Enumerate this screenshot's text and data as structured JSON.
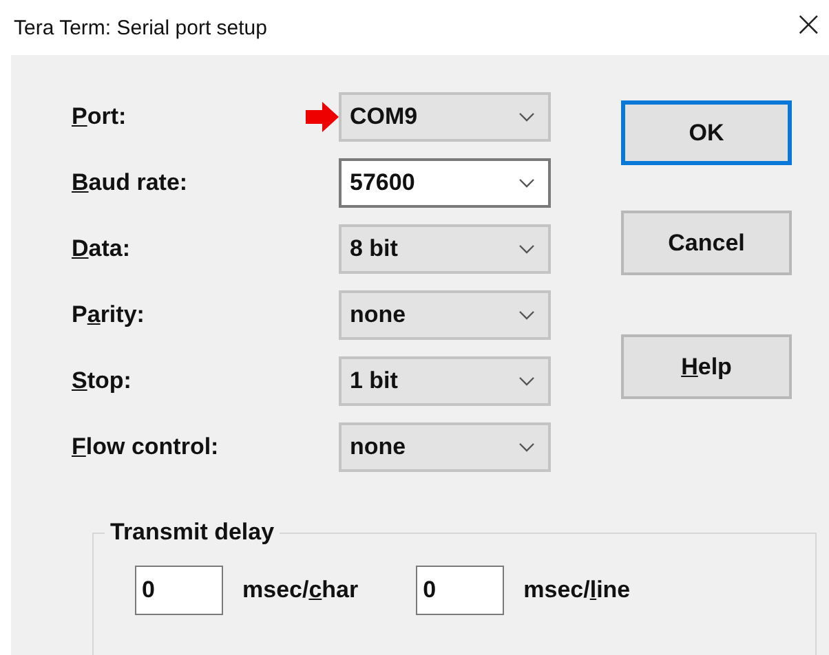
{
  "window": {
    "title": "Tera Term: Serial port setup",
    "close": "×"
  },
  "fields": [
    {
      "label": {
        "key": "P",
        "after": "ort:"
      },
      "value": "COM9",
      "focused": false,
      "annotated": true
    },
    {
      "label": {
        "key": "B",
        "after": "aud rate:"
      },
      "value": "57600",
      "focused": true,
      "annotated": false
    },
    {
      "label": {
        "key": "D",
        "after": "ata:"
      },
      "value": "8 bit",
      "focused": false,
      "annotated": false
    },
    {
      "label": {
        "before": "P",
        "key": "a",
        "after": "rity:"
      },
      "value": "none",
      "focused": false,
      "annotated": false
    },
    {
      "label": {
        "key": "S",
        "after": "top:"
      },
      "value": "1 bit",
      "focused": false,
      "annotated": false
    },
    {
      "label": {
        "key": "F",
        "after": "low control:"
      },
      "value": "none",
      "focused": false,
      "annotated": false
    }
  ],
  "buttons": [
    {
      "label": {
        "after": "OK"
      },
      "default": true
    },
    {
      "label": {
        "after": "Cancel"
      },
      "default": false
    },
    {
      "label": {
        "key": "H",
        "after": "elp"
      },
      "default": false
    }
  ],
  "transmit_delay": {
    "title": "Transmit delay",
    "inputs": [
      {
        "value": "0",
        "unit": {
          "before": "msec/",
          "key": "c",
          "after": "har"
        }
      },
      {
        "value": "0",
        "unit": {
          "before": "msec/",
          "key": "l",
          "after": "ine"
        }
      }
    ]
  }
}
